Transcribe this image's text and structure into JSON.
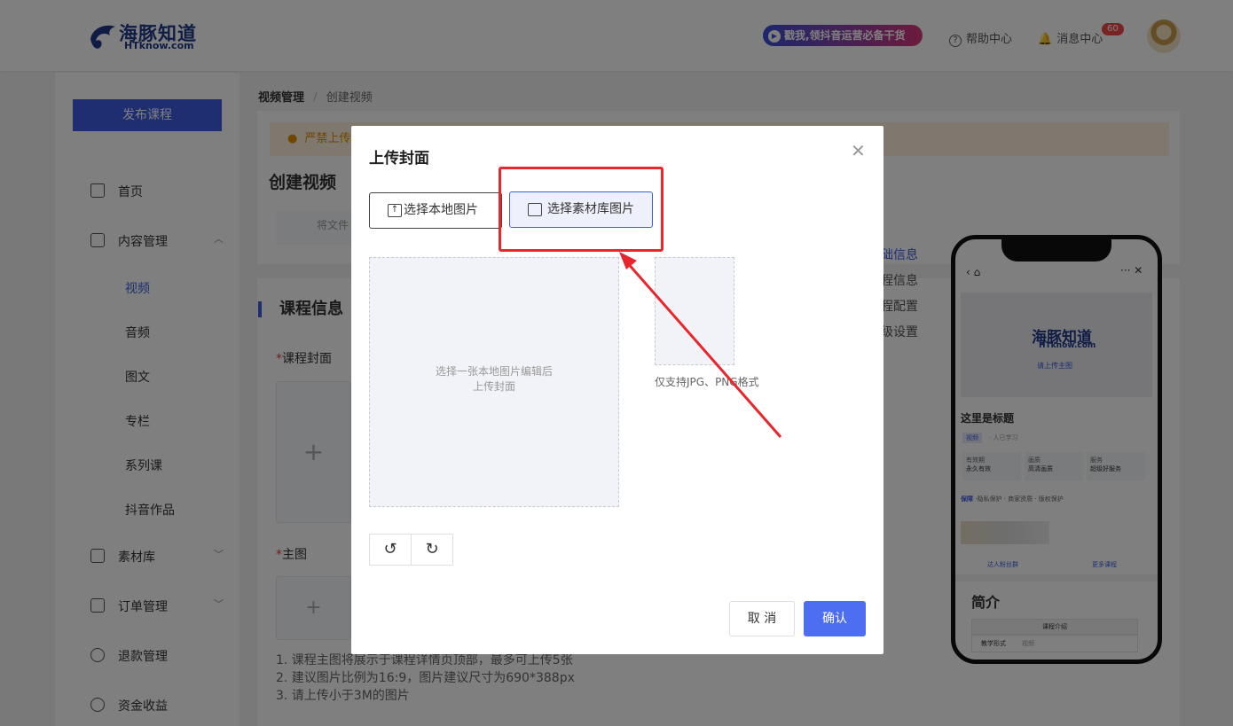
{
  "header": {
    "logo_cn": "海豚知道",
    "logo_en": "HTknow.com",
    "promo": "戳我,领抖音运营必备干货",
    "help": "帮助中心",
    "messages": "消息中心",
    "message_count": "60"
  },
  "sidebar": {
    "publish": "发布课程",
    "items": [
      {
        "label": "首页",
        "icon": "home-icon"
      },
      {
        "label": "内容管理",
        "icon": "content-icon"
      },
      {
        "label": "素材库",
        "icon": "folder-icon"
      },
      {
        "label": "订单管理",
        "icon": "order-icon"
      },
      {
        "label": "退款管理",
        "icon": "refund-icon"
      },
      {
        "label": "资金收益",
        "icon": "money-icon"
      }
    ],
    "sub_items": [
      "视频",
      "音频",
      "图文",
      "专栏",
      "系列课",
      "抖音作品"
    ]
  },
  "page": {
    "breadcrumb_parent": "视频管理",
    "breadcrumb_sep": "/",
    "breadcrumb_current": "创建视频",
    "warning": "严禁上传",
    "title": "创建视频",
    "upload_hint": "将文件",
    "section_title": "课程信息",
    "cover_label": "课程封面",
    "main_image_label": "主图",
    "notes": [
      "1. 课程主图将展示于课程详情页顶部，最多可上传5张",
      "2. 建议图片比例为16:9，图片建议尺寸为690*388px",
      "3. 请上传小于3M的图片"
    ],
    "right_nav": [
      "础信息",
      "程信息",
      "程配置",
      "级设置"
    ]
  },
  "phone": {
    "logo_cn": "海豚知道",
    "logo_en": "HTknow.com",
    "upload_main": "请上传主图",
    "title": "这里是标题",
    "tag": "视频",
    "learners": "· 人已学习",
    "features": [
      {
        "top": "有效期",
        "bottom": "永久有效"
      },
      {
        "top": "画质",
        "bottom": "高清画质"
      },
      {
        "top": "服务",
        "bottom": "超级好服务"
      }
    ],
    "guarantee_label": "保障",
    "guarantee_text": "·隐私保护 · 商家资质 · 版权保护",
    "link_left": "达人粉丝群",
    "link_right": "更多课程",
    "intro_title": "简介",
    "table_header": "课程介绍",
    "row_label": "教学形式",
    "row_value": "视频"
  },
  "modal": {
    "title": "上传封面",
    "btn_local": "选择本地图片",
    "btn_library": "选择素材库图片",
    "crop_line1": "选择一张本地图片编辑后",
    "crop_line2": "上传封面",
    "format_hint": "仅支持JPG、PNG格式",
    "cancel": "取 消",
    "confirm": "确认"
  },
  "colors": {
    "accent": "#3d5de0",
    "confirm": "#4e6ef2",
    "annotation": "#e8262c",
    "warning_bg": "#fdf1dc"
  }
}
